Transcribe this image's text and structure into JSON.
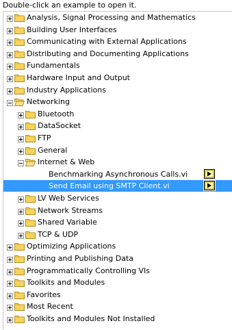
{
  "instruction": "Double-click an example to open it.",
  "tree": {
    "rows": [
      {
        "label": "Analysis, Signal Processing and Mathematics",
        "depth": 0,
        "expanded": false,
        "type": "folder",
        "selected": false
      },
      {
        "label": "Building User Interfaces",
        "depth": 0,
        "expanded": false,
        "type": "folder",
        "selected": false
      },
      {
        "label": "Communicating with External Applications",
        "depth": 0,
        "expanded": false,
        "type": "folder",
        "selected": false
      },
      {
        "label": "Distributing and Documenting Applications",
        "depth": 0,
        "expanded": false,
        "type": "folder",
        "selected": false
      },
      {
        "label": "Fundamentals",
        "depth": 0,
        "expanded": false,
        "type": "folder",
        "selected": false
      },
      {
        "label": "Hardware Input and Output",
        "depth": 0,
        "expanded": false,
        "type": "folder",
        "selected": false
      },
      {
        "label": "Industry Applications",
        "depth": 0,
        "expanded": false,
        "type": "folder",
        "selected": false
      },
      {
        "label": "Networking",
        "depth": 0,
        "expanded": true,
        "type": "folder",
        "selected": false
      },
      {
        "label": "Bluetooth",
        "depth": 1,
        "expanded": false,
        "type": "folder",
        "selected": false
      },
      {
        "label": "DataSocket",
        "depth": 1,
        "expanded": false,
        "type": "folder",
        "selected": false
      },
      {
        "label": "FTP",
        "depth": 1,
        "expanded": false,
        "type": "folder",
        "selected": false
      },
      {
        "label": "General",
        "depth": 1,
        "expanded": false,
        "type": "folder",
        "selected": false
      },
      {
        "label": "Internet & Web",
        "depth": 1,
        "expanded": true,
        "type": "folder",
        "selected": false
      },
      {
        "label": "Benchmarking Asynchronous Calls.vi",
        "depth": 2,
        "type": "vi",
        "selected": false
      },
      {
        "label": "Send Email using SMTP Client.vi",
        "depth": 2,
        "type": "vi",
        "selected": true
      },
      {
        "label": "LV Web Services",
        "depth": 1,
        "expanded": false,
        "type": "folder",
        "selected": false
      },
      {
        "label": "Network Streams",
        "depth": 1,
        "expanded": false,
        "type": "folder",
        "selected": false
      },
      {
        "label": "Shared Variable",
        "depth": 1,
        "expanded": false,
        "type": "folder",
        "selected": false
      },
      {
        "label": "TCP & UDP",
        "depth": 1,
        "expanded": false,
        "type": "folder",
        "selected": false
      },
      {
        "label": "Optimizing Applications",
        "depth": 0,
        "expanded": false,
        "type": "folder",
        "selected": false
      },
      {
        "label": "Printing and Publishing Data",
        "depth": 0,
        "expanded": false,
        "type": "folder",
        "selected": false
      },
      {
        "label": "Programmatically Controlling VIs",
        "depth": 0,
        "expanded": false,
        "type": "folder",
        "selected": false
      },
      {
        "label": "Toolkits and Modules",
        "depth": 0,
        "expanded": false,
        "type": "folder",
        "selected": false
      },
      {
        "label": "Favorites",
        "depth": 0,
        "expanded": false,
        "type": "folder",
        "selected": false
      },
      {
        "label": "Most Recent",
        "depth": 0,
        "expanded": false,
        "type": "folder",
        "selected": false
      },
      {
        "label": "Toolkits and Modules Not Installed",
        "depth": 0,
        "expanded": false,
        "type": "folder",
        "selected": false
      }
    ]
  },
  "colors": {
    "selection": "#3399ff",
    "folder_fill": "#f5d35e",
    "folder_stroke": "#b08a1a",
    "vi_icon_fill": "#f3e54a"
  },
  "icons": {
    "toggle_collapsed": "plus-box-icon",
    "toggle_expanded": "minus-box-icon",
    "folder_closed": "folder-icon",
    "folder_open": "folder-open-icon",
    "vi": "vi-file-icon"
  }
}
